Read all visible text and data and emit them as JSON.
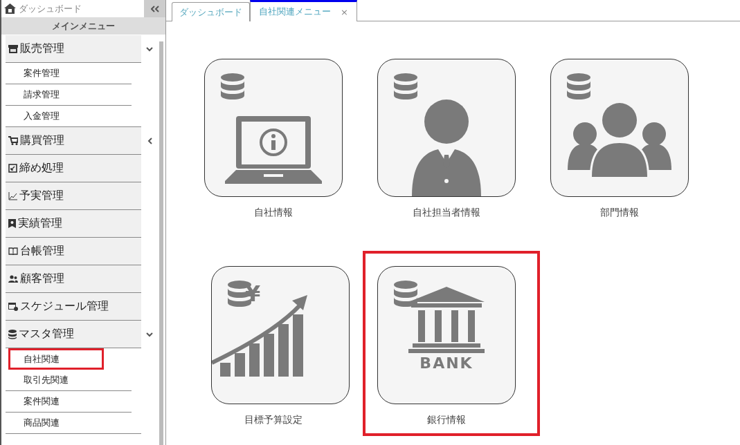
{
  "sidebar": {
    "home_link": "ダッシュボード",
    "title": "メインメニュー",
    "groups": [
      {
        "label": "販売管理",
        "expanded": true,
        "children": [
          {
            "label": "案件管理",
            "highlighted": false
          },
          {
            "label": "請求管理",
            "highlighted": false
          },
          {
            "label": "入金管理",
            "highlighted": false
          }
        ]
      },
      {
        "label": "購買管理",
        "expanded": false
      },
      {
        "label": "締め処理"
      },
      {
        "label": "予実管理"
      },
      {
        "label": "実績管理"
      },
      {
        "label": "台帳管理"
      },
      {
        "label": "顧客管理"
      },
      {
        "label": "スケジュール管理"
      },
      {
        "label": "マスタ管理",
        "expanded": true,
        "children": [
          {
            "label": "自社関連",
            "highlighted": true
          },
          {
            "label": "取引先関連",
            "highlighted": false
          },
          {
            "label": "案件関連",
            "highlighted": false
          },
          {
            "label": "商品関連",
            "highlighted": false
          }
        ]
      }
    ]
  },
  "tabs": [
    {
      "label": "ダッシュボード",
      "selected": false
    },
    {
      "label": "自社関連メニュー",
      "selected": true,
      "close": "×"
    }
  ],
  "tiles": [
    {
      "label": "自社情報",
      "kind": "laptop",
      "highlighted": false
    },
    {
      "label": "自社担当者情報",
      "kind": "person",
      "highlighted": false
    },
    {
      "label": "部門情報",
      "kind": "group",
      "highlighted": false
    },
    {
      "label": "目標予算設定",
      "kind": "budget",
      "highlighted": false,
      "symbol": "¥"
    },
    {
      "label": "銀行情報",
      "kind": "bank",
      "highlighted": true,
      "sign": "BANK"
    }
  ]
}
